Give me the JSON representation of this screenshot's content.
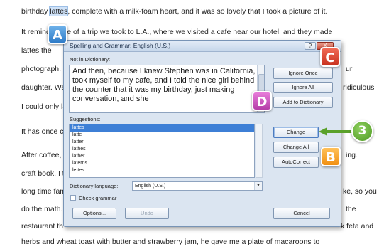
{
  "document": {
    "lines": [
      {
        "pre": "birthday ",
        "highlight": "lattes",
        "post": ", complete with a milk-foam heart, and it was so lovely that I took a picture of it."
      },
      {
        "pre": "I",
        "highlight": "",
        "post": "t reminded me of a trip we took to L.A., where we visited a cafe near our hotel, and they made"
      },
      {
        "pre": "",
        "highlight": "",
        "post": "lattes the"
      },
      {
        "pre": "",
        "highlight": "",
        "post": "photograph. L"
      },
      {
        "pre": "",
        "highlight": "",
        "post": "daughter. We"
      },
      {
        "pre": "",
        "highlight": "",
        "post": "I could only la"
      },
      {
        "pre": "",
        "highlight": "",
        "post": "It has once ca"
      },
      {
        "pre": "",
        "highlight": "",
        "post": "After coffee, c"
      },
      {
        "pre": "",
        "highlight": "",
        "post": "craft book, I t"
      },
      {
        "pre": "",
        "highlight": "",
        "post": "long time fam"
      },
      {
        "pre": "",
        "highlight": "",
        "post": "do the math. "
      },
      {
        "pre": "",
        "highlight": "",
        "post": "restaurant th"
      },
      {
        "pre": "",
        "highlight": "",
        "post": "herbs and wheat toast with butter and strawberry jam, he gave me a plate of macaroons to"
      }
    ],
    "right_fragments": [
      {
        "text": "ur"
      },
      {
        "text": "ridiculous"
      },
      {
        "text": "ing."
      },
      {
        "text": "ke, so you"
      },
      {
        "text": "the"
      },
      {
        "text": "k feta and"
      }
    ]
  },
  "dialog": {
    "title": "Spelling and Grammar: English (U.S.)",
    "help_label": "?",
    "close_label": "X",
    "not_in_dictionary_label": "Not in Dictionary:",
    "not_in_dictionary_text": "And then, because I knew Stephen was in California, I took myself to my cafe, and I told the nice girl behind the counter that it was my birthday, just making conversation, and she",
    "suggestions_label": "Suggestions:",
    "suggestions": [
      "lattes",
      "latte",
      "latter",
      "lathes",
      "lather",
      "laterns",
      "lettes"
    ],
    "selected_suggestion_index": 0,
    "dictionary_language_label": "Dictionary language:",
    "dictionary_language_value": "English (U.S.)",
    "check_grammar_label": "Check grammar",
    "buttons": {
      "ignore_once": "Ignore Once",
      "ignore_all": "Ignore All",
      "add_to_dictionary": "Add to Dictionary",
      "change": "Change",
      "change_all": "Change All",
      "autocorrect": "AutoCorrect",
      "options": "Options...",
      "undo": "Undo",
      "cancel": "Cancel"
    }
  },
  "callouts": {
    "a": "A",
    "b": "B",
    "c": "C",
    "d": "D",
    "step": "3"
  },
  "colors": {
    "callout_a": "#2f7cc8",
    "callout_b": "#f19012",
    "callout_c": "#c8321f",
    "callout_d": "#b43ea8",
    "callout_step": "#4e9a23",
    "selection": "#3d7fd6"
  }
}
